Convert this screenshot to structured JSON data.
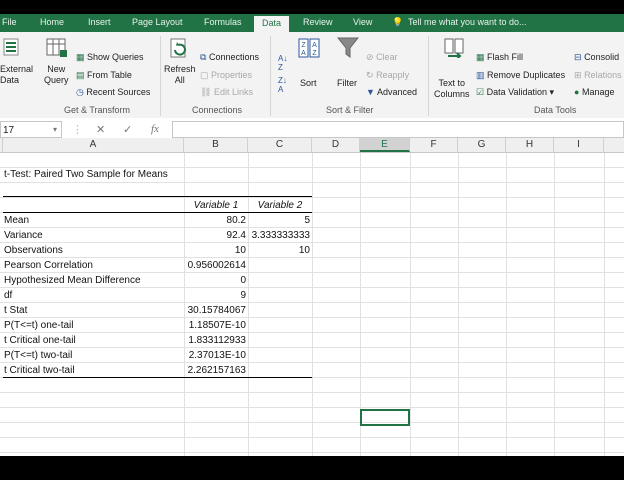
{
  "ribbon": {
    "tabs": [
      "File",
      "Home",
      "Insert",
      "Page Layout",
      "Formulas",
      "Data",
      "Review",
      "View",
      "Tell me what you want to do..."
    ],
    "active_tab": "Data",
    "get_transform": {
      "external_data": "External\nData",
      "new_query": "New\nQuery",
      "show_queries": "Show Queries",
      "from_table": "From Table",
      "recent_sources": "Recent Sources",
      "group_label": "Get & Transform"
    },
    "connections": {
      "refresh_all": "Refresh\nAll",
      "connections": "Connections",
      "properties": "Properties",
      "edit_links": "Edit Links",
      "group_label": "Connections"
    },
    "sort_filter": {
      "sort": "Sort",
      "filter": "Filter",
      "clear": "Clear",
      "reapply": "Reapply",
      "advanced": "Advanced",
      "group_label": "Sort & Filter"
    },
    "data_tools": {
      "text_to_columns": "Text to\nColumns",
      "flash_fill": "Flash Fill",
      "remove_duplicates": "Remove Duplicates",
      "data_validation": "Data Validation",
      "consolidate": "Consolid",
      "relationships": "Relations",
      "manage": "Manage",
      "group_label": "Data Tools"
    }
  },
  "formula_bar": {
    "name_box": "17",
    "cancel": "✕",
    "enter": "✓",
    "fx": "fx",
    "value": ""
  },
  "columns": [
    "A",
    "B",
    "C",
    "D",
    "E",
    "F",
    "G",
    "H",
    "I"
  ],
  "selected_column": "E",
  "sheet": {
    "title": "t-Test: Paired Two Sample for Means",
    "headers": [
      "Variable 1",
      "Variable 2"
    ],
    "rows": [
      {
        "label": "Mean",
        "v1": "80.2",
        "v2": "5"
      },
      {
        "label": "Variance",
        "v1": "92.4",
        "v2": "3.333333333"
      },
      {
        "label": "Observations",
        "v1": "10",
        "v2": "10"
      },
      {
        "label": "Pearson Correlation",
        "v1": "0.956002614",
        "v2": ""
      },
      {
        "label": "Hypothesized Mean Difference",
        "v1": "0",
        "v2": ""
      },
      {
        "label": "df",
        "v1": "9",
        "v2": ""
      },
      {
        "label": "t Stat",
        "v1": "30.15784067",
        "v2": ""
      },
      {
        "label": "P(T<=t) one-tail",
        "v1": "1.18507E-10",
        "v2": ""
      },
      {
        "label": "t Critical one-tail",
        "v1": "1.833112933",
        "v2": ""
      },
      {
        "label": "P(T<=t) two-tail",
        "v1": "2.37013E-10",
        "v2": ""
      },
      {
        "label": "t Critical two-tail",
        "v1": "2.262157163",
        "v2": ""
      }
    ]
  },
  "colors": {
    "accent": "#217346"
  }
}
